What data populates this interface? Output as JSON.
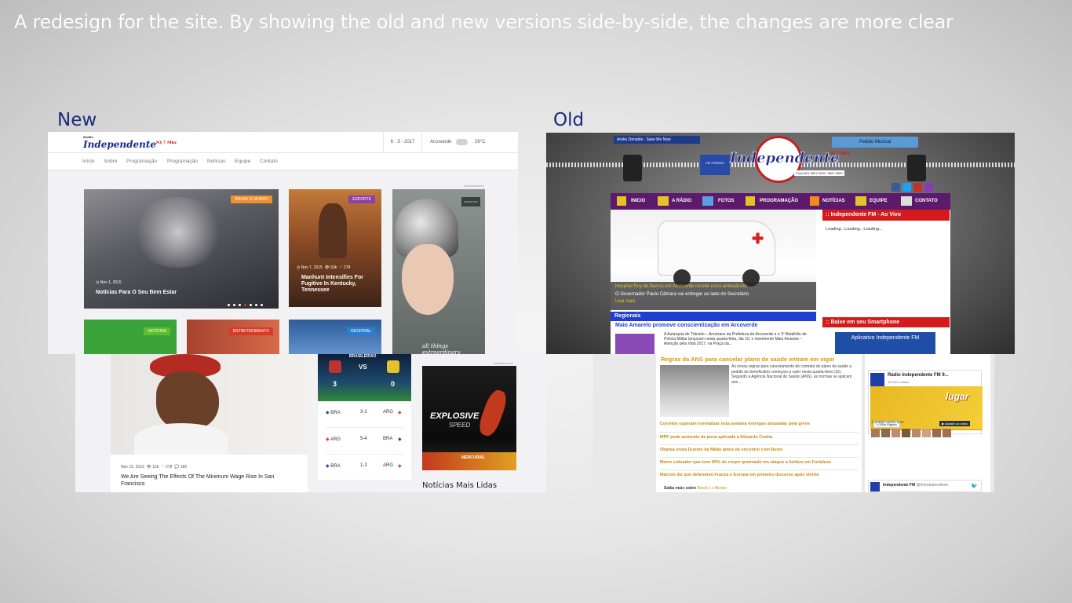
{
  "headline": "A redesign for the site. By showing the old and new versions side-by-side, the changes are more clear",
  "labels": {
    "new": "New",
    "old": "Old"
  },
  "new_site": {
    "logo": {
      "small": "Rádio",
      "main": "Independente",
      "freq": "93,7 Mhz"
    },
    "date": "6 - 3 - 2017",
    "city": "Arcoverde",
    "temp": "26°C",
    "nav": [
      "Início",
      "Sobre",
      "Programação",
      "Programação",
      "Notícias",
      "Equipe",
      "Contato"
    ],
    "ad_label": "Advertisement",
    "cards": {
      "hero": {
        "tag": "BRASIL E MUNDO",
        "date": "Nov 1, 2015",
        "title": "Notícias Para O Seu Bem Estar"
      },
      "esporte": {
        "tag": "ESPORTE",
        "date": "Nov 7, 2015",
        "views": "53k",
        "likes": "278",
        "title": "Manhunt Intensifies For Fugitive In Kentucky, Tennessee"
      },
      "ad": {
        "caption": "all things extraordinary",
        "brand": "SWAROVSKI"
      },
      "noticias": {
        "tag": "NOTÍCIAS"
      },
      "entretenimento": {
        "tag": "ENTRETERIMENTO"
      },
      "regional": {
        "tag": "REGIONAL"
      },
      "feature": {
        "date": "Nov 15, 2015",
        "views": "15k",
        "likes": "278",
        "comments": "189",
        "title": "We Are Seeing The Effects Of The Minimum Wage Rise In San Francisco"
      }
    },
    "scores": {
      "header": "BRASILEIRÃO",
      "home": "3",
      "away": "0",
      "vs": "VS",
      "rows": [
        {
          "a": "BRA",
          "score": "3-2",
          "b": "ARG"
        },
        {
          "a": "ARG",
          "score": "5-4",
          "b": "BRA"
        },
        {
          "a": "BRA",
          "score": "1-2",
          "b": "ARG"
        }
      ]
    },
    "ad2": {
      "label": "Advertisement",
      "line1": "EXPLOSIVE",
      "line2": "SPEED",
      "brand": "MERCURIAL"
    },
    "most_read": "Notícias Mais Lidas"
  },
  "old_site": {
    "now_playing": "Andru Donalds - Save Me Now",
    "logo": "Independente",
    "freq": "93,7 Mhz",
    "stereo": "FM STÉREO",
    "phone": "Fone:(87) 3821.0100 / 3821.0500",
    "pedido": "Pedido Musical",
    "nav": [
      "INICIO",
      "A RÁDIO",
      "FOTOS",
      "PROGRAMAÇÃO",
      "NOTÍCIAS",
      "EQUIPE",
      "CONTATO"
    ],
    "live_title": ":: Independente FM - Ao Vivo",
    "loading": "Loading...Loading...Loading...",
    "hero_caption": "Hospital Ruy de Barros em Arcoverde recebe nova ambulância",
    "hero_sub": "O Governador Paulo Câmara vai entregar ao lado do Secretário",
    "leia": "Leia mais",
    "regionais": "Regionais",
    "regionais_title": "Maio Amarelo promove conscientização em Arcoverde",
    "regionais_text": "A Autarquia de Trânsito – Arcotrans da Prefeitura de Arcoverde e o 3º Batalhão de Polícia Militar lançaram nesta quarta-feira, dia 10, o movimento Maio Amarelo – Atenção pela Vida 2017, na Praça da...",
    "smartphone": ":: Baixe em seu Smartphone",
    "app": "Aplicativo Independente FM",
    "ans_title": "Regras da ANS para cancelar plano de saúde entram em vigor",
    "ans_text": "As novas regras para cancelamento de contrato do plano de saúde a pedido do beneficiário começam a valer nesta quarta-feira (10). Segundo a Agência Nacional de Saúde (ANS), as normas se aplicam aos...",
    "headlines": [
      "Correios esperam normalizar esta semana entregas atrasadas pela greve",
      "MPF pede aumento de pena aplicada a Eduardo Cunha",
      "Obama visita Duomo de Milão antes de encontro com Renzi",
      "Morre cobrador que teve 90% do corpo queimado em ataque a ônibus em Fortaleza",
      "Macron diz que defenderá França e Europa em primeiro discurso após vitória"
    ],
    "saiba": "Saiba mais sobre",
    "saiba_links": "Brasil e o Mundo",
    "fb_page": "Rádio Independente FM 9...",
    "fb_likes": "18.000 curtidas",
    "fb_like_btn": "Curtir Página",
    "fb_video": "Assistir ao vídeo",
    "fb_friend": "1 amigo curtiu isso",
    "tw_name": "Independente FM",
    "tw_handle": "@fmindependente",
    "fb_banner": "lugar"
  }
}
